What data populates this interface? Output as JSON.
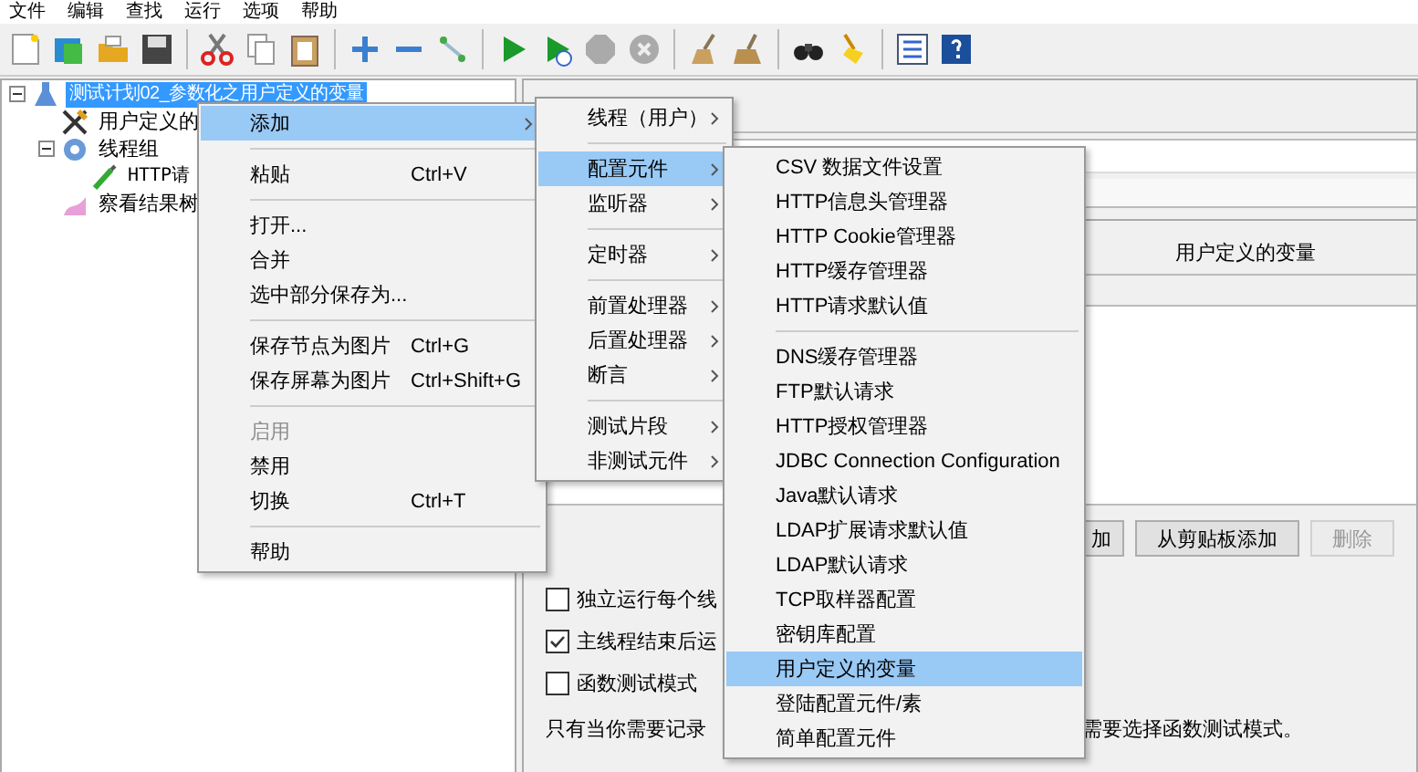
{
  "menu_bar": [
    "文件",
    "编辑",
    "查找",
    "运行",
    "选项",
    "帮助"
  ],
  "tree": [
    {
      "label": "测试计划02_参数化之用户定义的变量",
      "kind": "plan",
      "selected": true,
      "expanded": true,
      "children": [
        {
          "label": "用户定义的",
          "kind": "config",
          "selected": false
        },
        {
          "label": "线程组",
          "kind": "threads",
          "selected": false,
          "expanded": true,
          "children": [
            {
              "label": "HTTP请",
              "kind": "sampler",
              "selected": false
            }
          ]
        },
        {
          "label": "察看结果树",
          "kind": "listener",
          "selected": false
        }
      ]
    }
  ],
  "panel": {
    "table_title": "用户定义的变量",
    "buttons": [
      {
        "label": "加",
        "disabled": false
      },
      {
        "label": "从剪贴板添加",
        "disabled": false
      },
      {
        "label": "删除",
        "disabled": true
      }
    ],
    "options": [
      {
        "label": "独立运行每个线",
        "checked": false
      },
      {
        "label": "主线程结束后运",
        "checked": true
      },
      {
        "label": "函数测试模式",
        "checked": false
      }
    ],
    "note_start": "只有当你需要记录",
    "note_end": "需要选择函数测试模式。"
  },
  "context_menu": [
    {
      "kind": "item",
      "label": "添加",
      "submenu": true,
      "selected": true
    },
    {
      "kind": "separator"
    },
    {
      "kind": "item",
      "label": "粘贴",
      "shortcut": "Ctrl+V",
      "selected": false
    },
    {
      "kind": "separator"
    },
    {
      "kind": "item",
      "label": "打开...",
      "selected": false
    },
    {
      "kind": "item",
      "label": "合并",
      "selected": false
    },
    {
      "kind": "item",
      "label": "选中部分保存为...",
      "selected": false
    },
    {
      "kind": "separator"
    },
    {
      "kind": "item",
      "label": "保存节点为图片",
      "shortcut": "Ctrl+G",
      "selected": false
    },
    {
      "kind": "item",
      "label": "保存屏幕为图片",
      "shortcut": "Ctrl+Shift+G",
      "selected": false
    },
    {
      "kind": "separator"
    },
    {
      "kind": "item",
      "label": "启用",
      "disabled": true,
      "selected": false
    },
    {
      "kind": "item",
      "label": "禁用",
      "selected": false
    },
    {
      "kind": "item",
      "label": "切换",
      "shortcut": "Ctrl+T",
      "selected": false
    },
    {
      "kind": "separator"
    },
    {
      "kind": "item",
      "label": "帮助",
      "selected": false
    }
  ],
  "add_menu": [
    {
      "kind": "item",
      "label": "线程（用户）",
      "submenu": true,
      "selected": false
    },
    {
      "kind": "separator"
    },
    {
      "kind": "item",
      "label": "配置元件",
      "submenu": true,
      "selected": true
    },
    {
      "kind": "item",
      "label": "监听器",
      "submenu": true,
      "selected": false
    },
    {
      "kind": "separator"
    },
    {
      "kind": "item",
      "label": "定时器",
      "submenu": true,
      "selected": false
    },
    {
      "kind": "separator"
    },
    {
      "kind": "item",
      "label": "前置处理器",
      "submenu": true,
      "selected": false
    },
    {
      "kind": "item",
      "label": "后置处理器",
      "submenu": true,
      "selected": false
    },
    {
      "kind": "item",
      "label": "断言",
      "submenu": true,
      "selected": false
    },
    {
      "kind": "separator"
    },
    {
      "kind": "item",
      "label": "测试片段",
      "submenu": true,
      "selected": false
    },
    {
      "kind": "item",
      "label": "非测试元件",
      "submenu": true,
      "selected": false
    }
  ],
  "config_menu": [
    {
      "kind": "item",
      "label": "CSV 数据文件设置",
      "selected": false
    },
    {
      "kind": "item",
      "label": "HTTP信息头管理器",
      "selected": false
    },
    {
      "kind": "item",
      "label": "HTTP Cookie管理器",
      "selected": false
    },
    {
      "kind": "item",
      "label": "HTTP缓存管理器",
      "selected": false
    },
    {
      "kind": "item",
      "label": "HTTP请求默认值",
      "selected": false
    },
    {
      "kind": "separator"
    },
    {
      "kind": "item",
      "label": "DNS缓存管理器",
      "selected": false
    },
    {
      "kind": "item",
      "label": "FTP默认请求",
      "selected": false
    },
    {
      "kind": "item",
      "label": "HTTP授权管理器",
      "selected": false
    },
    {
      "kind": "item",
      "label": "JDBC Connection Configuration",
      "selected": false
    },
    {
      "kind": "item",
      "label": "Java默认请求",
      "selected": false
    },
    {
      "kind": "item",
      "label": "LDAP扩展请求默认值",
      "selected": false
    },
    {
      "kind": "item",
      "label": "LDAP默认请求",
      "selected": false
    },
    {
      "kind": "item",
      "label": "TCP取样器配置",
      "selected": false
    },
    {
      "kind": "item",
      "label": "密钥库配置",
      "selected": false
    },
    {
      "kind": "item",
      "label": "用户定义的变量",
      "selected": true
    },
    {
      "kind": "item",
      "label": "登陆配置元件/素",
      "selected": false
    },
    {
      "kind": "item",
      "label": "简单配置元件",
      "selected": false
    }
  ]
}
